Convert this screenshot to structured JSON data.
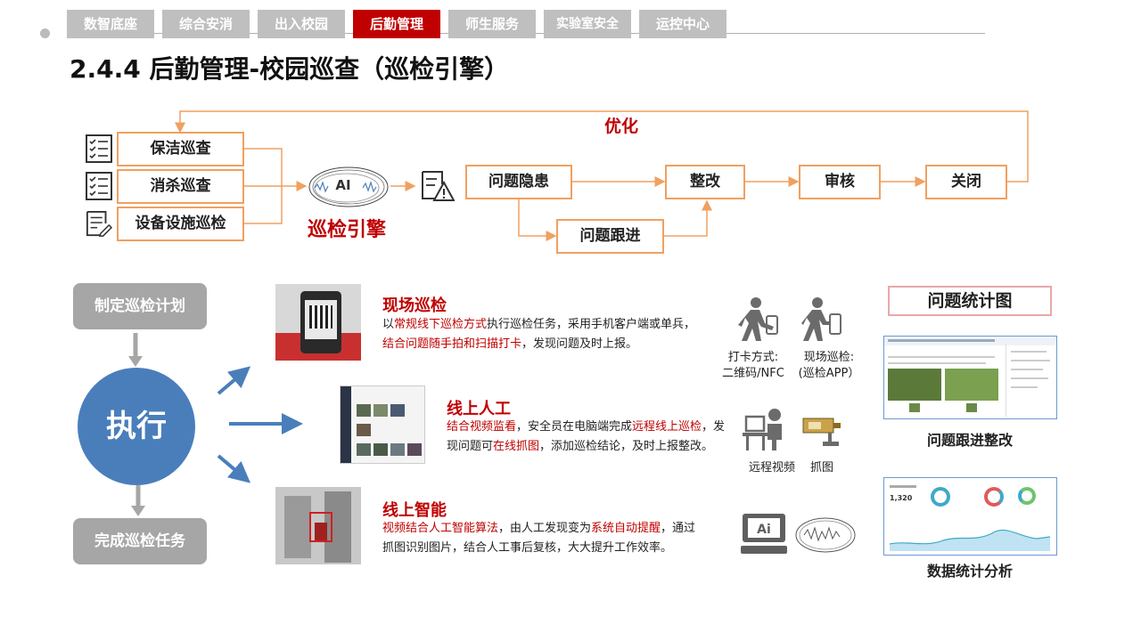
{
  "nav": {
    "tabs": [
      {
        "label": "数智底座",
        "active": false
      },
      {
        "label": "综合安消",
        "active": false
      },
      {
        "label": "出入校园",
        "active": false
      },
      {
        "label": "后勤管理",
        "active": true
      },
      {
        "label": "师生服务",
        "active": false
      },
      {
        "label": "实验室安全",
        "active": false
      },
      {
        "label": "运控中心",
        "active": false
      }
    ]
  },
  "page": {
    "title": "2.4.4 后勤管理-校园巡查（巡检引擎）"
  },
  "flow": {
    "inputs": [
      "保洁巡查",
      "消杀巡查",
      "设备设施巡检"
    ],
    "engine_text": "AI",
    "engine_label": "巡检引擎",
    "optimize_label": "优化",
    "steps": {
      "issue": "问题隐患",
      "rectify": "整改",
      "review": "审核",
      "close": "关闭",
      "track": "问题跟进"
    }
  },
  "process": {
    "plan": "制定巡检计划",
    "execute": "执行",
    "complete": "完成巡检任务"
  },
  "methods": {
    "onsite": {
      "title": "现场巡检",
      "desc": {
        "p1": "以",
        "r1": "常规线下巡检方式",
        "p2": "执行巡检任务，采用手机客户端或单兵，",
        "r2": "结合问题随手拍和扫描打卡",
        "p3": "，发现问题及时上报。"
      }
    },
    "online_manual": {
      "title": "线上人工",
      "desc": {
        "r1": "结合视频监看",
        "p1": "，安全员在电脑端完成",
        "r2": "远程线上巡检",
        "p2": "，发现问题可",
        "r3": "在线抓图",
        "p3": "，添加巡检结论，及时上报整改。"
      }
    },
    "online_ai": {
      "title": "线上智能",
      "desc": {
        "r1": "视频结合人工智能算法",
        "p1": "，由人工发现变为",
        "r2": "系统自动提醒",
        "p2": "，通过抓图识别图片，结合人工事后复核，大大提升工作效率。"
      }
    }
  },
  "icons_captions": {
    "checkin": "打卡方式:\n二维码/NFC",
    "onsite_app": "现场巡检:\n(巡检APP）",
    "remote_video": "远程视频",
    "capture": "抓图"
  },
  "right": {
    "stat_title": "问题统计图",
    "track_caption": "问题跟进整改",
    "analysis_caption": "数据统计分析",
    "dash_value": "1,320"
  },
  "colors": {
    "accent_red": "#c00000",
    "flow_orange": "#f0a060",
    "circle_blue": "#4a7ebb",
    "gray_box": "#a6a6a6"
  }
}
